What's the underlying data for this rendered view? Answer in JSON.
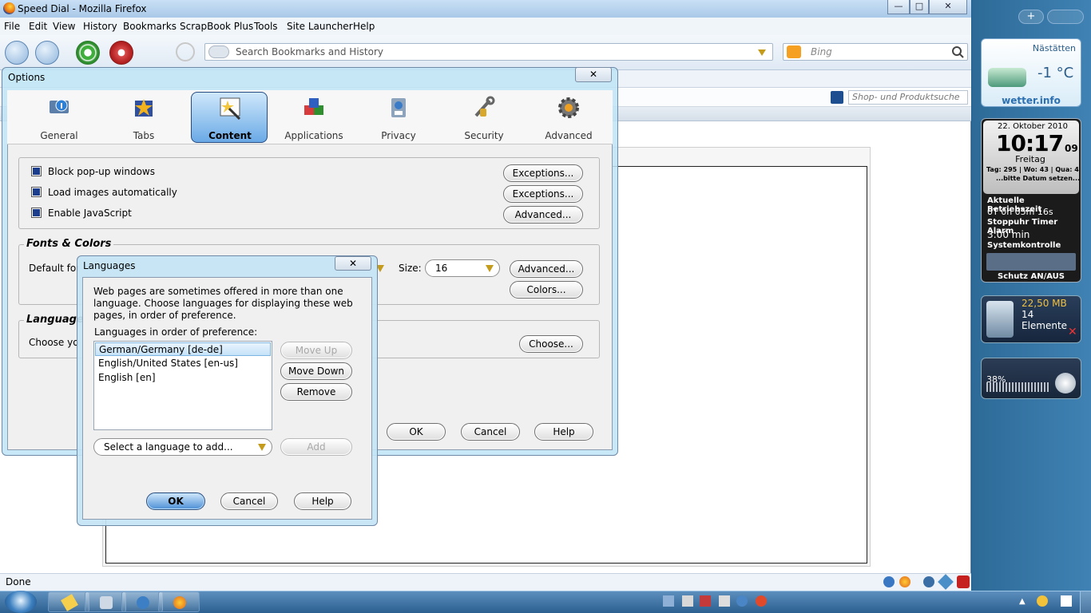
{
  "window": {
    "title": "Speed Dial - Mozilla Firefox",
    "minimize": "—",
    "maximize": "□",
    "close": "✕"
  },
  "menubar": [
    {
      "label": "File"
    },
    {
      "label": "Edit"
    },
    {
      "label": "View"
    },
    {
      "label": "History"
    },
    {
      "label": "Bookmarks"
    },
    {
      "label": "ScrapBook Plus"
    },
    {
      "label": "Tools"
    },
    {
      "label": "Site Launcher"
    },
    {
      "label": "Help"
    }
  ],
  "navbar": {
    "url_placeholder": "Search Bookmarks and History",
    "search_placeholder": "Bing"
  },
  "toolbar3": {
    "shop_placeholder": "Shop- und Produktsuche"
  },
  "statusbar": {
    "text": "Done"
  },
  "options": {
    "title": "Options",
    "close": "✕",
    "tabs": [
      {
        "label": "General"
      },
      {
        "label": "Tabs"
      },
      {
        "label": "Content"
      },
      {
        "label": "Applications"
      },
      {
        "label": "Privacy"
      },
      {
        "label": "Security"
      },
      {
        "label": "Advanced"
      }
    ],
    "selected_tab": "Content",
    "checks": [
      {
        "label": "Block pop-up windows",
        "button": "Exceptions..."
      },
      {
        "label": "Load images automatically",
        "button": "Exceptions..."
      },
      {
        "label": "Enable JavaScript",
        "button": "Advanced..."
      }
    ],
    "fonts": {
      "title": "Fonts & Colors",
      "default_font_label": "Default font:",
      "size_label": "Size:",
      "size_value": "16",
      "advanced_button": "Advanced...",
      "colors_button": "Colors..."
    },
    "languages": {
      "title": "Languages",
      "text": "Choose your preferred language for displaying pages",
      "choose_button": "Choose..."
    },
    "ok": "OK",
    "cancel": "Cancel",
    "help": "Help"
  },
  "languages_dialog": {
    "title": "Languages",
    "close": "✕",
    "description": "Web pages are sometimes offered in more than one language. Choose languages for displaying these web pages, in order of preference.",
    "list_label": "Languages in order of preference:",
    "items": [
      {
        "label": "German/Germany  [de-de]"
      },
      {
        "label": "English/United States  [en-us]"
      },
      {
        "label": "English  [en]"
      }
    ],
    "move_up": "Move Up",
    "move_down": "Move Down",
    "remove": "Remove",
    "select_placeholder": "Select a language to add...",
    "add": "Add",
    "ok": "OK",
    "cancel": "Cancel",
    "help": "Help"
  },
  "gadgets": {
    "weather": {
      "location": "Nästätten",
      "temp": "-1 °C",
      "brand": "wetter.info"
    },
    "clock": {
      "date": "22. Oktober 2010",
      "time": "10:17",
      "seconds": "09",
      "weekday": "Freitag",
      "info": "Tag: 295 | Wo: 43 | Qua: 4",
      "hint": "...bitte Datum setzen...",
      "uptime_label": "Aktuelle Betriebszeit",
      "uptime": "0T 0h 05m 16s",
      "stopwatch": "Stoppuhr Timer Alarm",
      "timer": "3:00 min",
      "control": "Systemkontrolle",
      "protect": "Schutz AN/AUS"
    },
    "recycle": {
      "size": "22,50 MB",
      "count": "14 Elemente"
    },
    "volume": {
      "percent": "38%"
    }
  }
}
